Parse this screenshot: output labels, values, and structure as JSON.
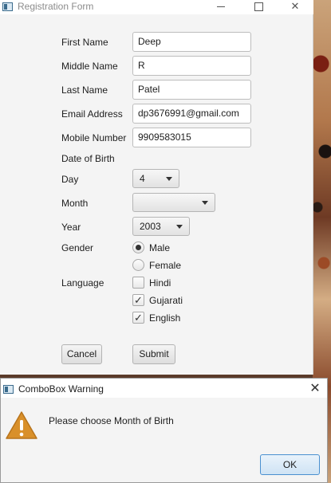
{
  "window": {
    "title": "Registration Form",
    "minimize": "",
    "maximize": "",
    "close": "✕"
  },
  "form": {
    "first_name": {
      "label": "First Name",
      "value": "Deep"
    },
    "middle_name": {
      "label": "Middle Name",
      "value": "R"
    },
    "last_name": {
      "label": "Last Name",
      "value": "Patel"
    },
    "email": {
      "label": "Email Address",
      "value": "dp3676991@gmail.com"
    },
    "mobile": {
      "label": "Mobile Number",
      "value": "9909583015"
    },
    "dob_label": "Date of Birth",
    "day": {
      "label": "Day",
      "value": "4"
    },
    "month": {
      "label": "Month",
      "value": ""
    },
    "year": {
      "label": "Year",
      "value": "2003"
    },
    "gender": {
      "label": "Gender",
      "options": [
        {
          "label": "Male",
          "selected": true
        },
        {
          "label": "Female",
          "selected": false
        }
      ]
    },
    "language": {
      "label": "Language",
      "options": [
        {
          "label": "Hindi",
          "checked": false
        },
        {
          "label": "Gujarati",
          "checked": true
        },
        {
          "label": "English",
          "checked": true
        }
      ]
    },
    "cancel_label": "Cancel",
    "submit_label": "Submit"
  },
  "dialog": {
    "title": "ComboBox Warning",
    "close": "✕",
    "message": "Please choose Month of Birth",
    "ok_label": "OK",
    "icon": "warning-icon",
    "icon_color": "#d9902a"
  }
}
